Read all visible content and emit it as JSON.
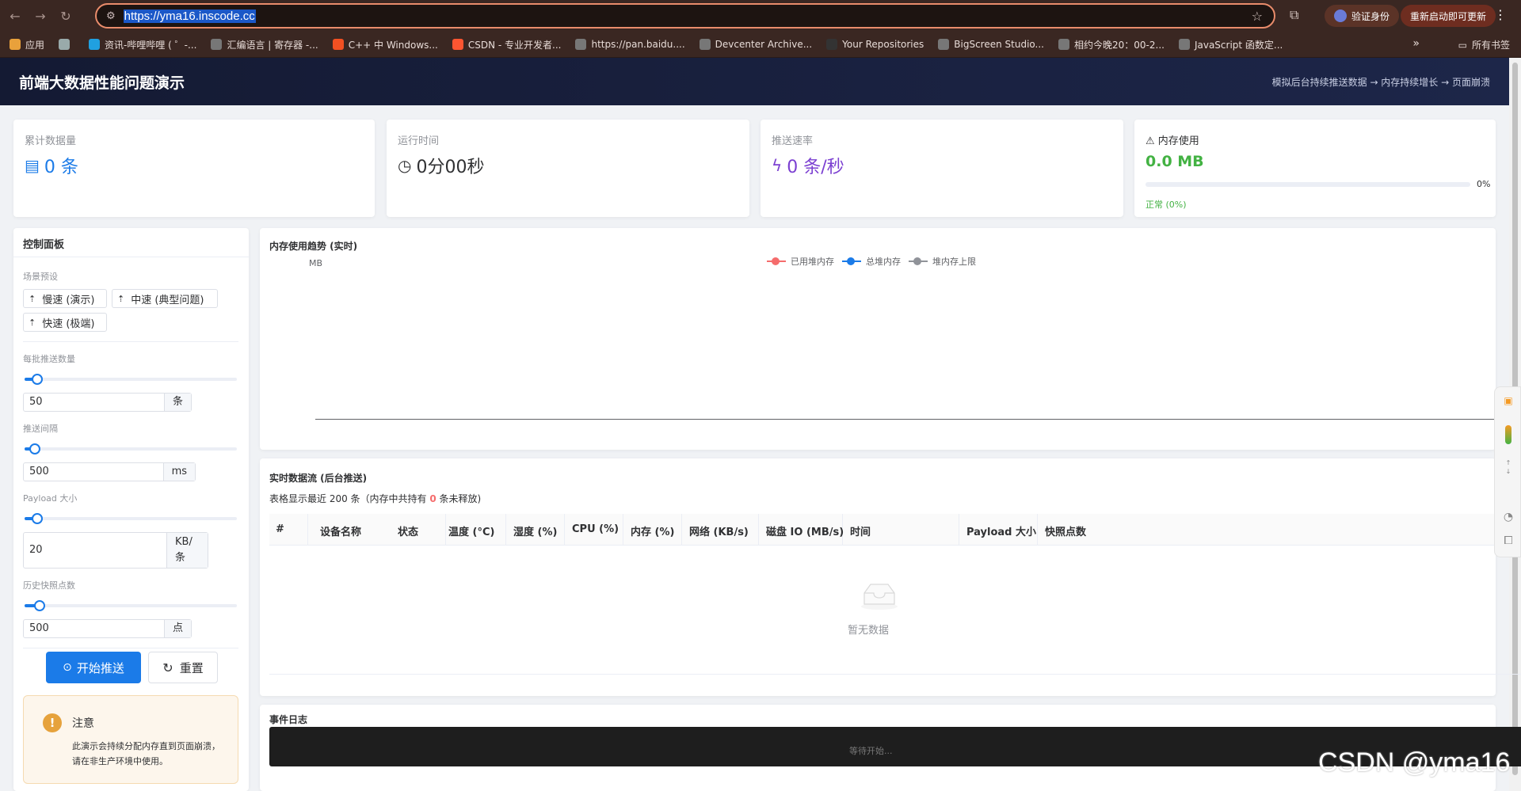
{
  "browser": {
    "url": "https://yma16.inscode.cc",
    "verify_label": "验证身份",
    "update_label": "重新启动即可更新",
    "bookmarks": [
      {
        "label": "应用",
        "color": "#e9a13b"
      },
      {
        "label": "",
        "color": "#9aa"
      },
      {
        "label": "资讯-哔哩哔哩 ( ゜-...",
        "color": "#20a0e0"
      },
      {
        "label": "汇编语言 | 寄存器 -...",
        "color": "#777"
      },
      {
        "label": "C++ 中 Windows...",
        "color": "#f25022"
      },
      {
        "label": "CSDN - 专业开发者...",
        "color": "#fc5531"
      },
      {
        "label": "https://pan.baidu....",
        "color": "#777"
      },
      {
        "label": "Devcenter Archive...",
        "color": "#777"
      },
      {
        "label": "Your Repositories",
        "color": "#333"
      },
      {
        "label": "BigScreen Studio...",
        "color": "#777"
      },
      {
        "label": "相约今晚20：00-2...",
        "color": "#777"
      },
      {
        "label": "JavaScript 函数定...",
        "color": "#777"
      }
    ],
    "all_bookmarks_label": "所有书签"
  },
  "header": {
    "title": "前端大数据性能问题演示",
    "subtitle": "模拟后台持续推送数据 → 内存持续增长 → 页面崩溃"
  },
  "stats": {
    "count": {
      "label": "累计数据量",
      "value": "0 条"
    },
    "runtime": {
      "label": "运行时间",
      "value": "0分00秒"
    },
    "rate": {
      "label": "推送速率",
      "value": "0 条/秒"
    },
    "memory": {
      "label": "内存使用",
      "value": "0.0 MB",
      "percent_text": "0%",
      "percent": 0,
      "status": "正常 (0%)"
    }
  },
  "control": {
    "title": "控制面板",
    "presets_label": "场景预设",
    "presets": [
      "慢速 (演示)",
      "中速 (典型问题)",
      "快速 (极端)"
    ],
    "batch": {
      "label": "每批推送数量",
      "value": "50",
      "unit": "条",
      "level": 0.06
    },
    "interval": {
      "label": "推送间隔",
      "value": "500",
      "unit": "ms",
      "level": 0.05
    },
    "payload": {
      "label": "Payload 大小",
      "value": "20",
      "unit": "KB/条",
      "level": 0.06
    },
    "snapshots": {
      "label": "历史快照点数",
      "value": "500",
      "unit": "点",
      "level": 0.07
    },
    "start_label": "开始推送",
    "reset_label": "重置",
    "notice_title": "注意",
    "notice_body": "此演示会持续分配内存直到页面崩溃，请在非生产环境中使用。"
  },
  "chart": {
    "title": "内存使用趋势 (实时)",
    "unit": "MB",
    "legend": [
      {
        "name": "已用堆内存",
        "color": "#f56c6c"
      },
      {
        "name": "总堆内存",
        "color": "#1b7be8"
      },
      {
        "name": "堆内存上限",
        "color": "#909399"
      }
    ]
  },
  "chart_data": {
    "type": "line",
    "title": "内存使用趋势 (实时)",
    "ylabel": "MB",
    "series": [
      {
        "name": "已用堆内存",
        "values": []
      },
      {
        "name": "总堆内存",
        "values": []
      },
      {
        "name": "堆内存上限",
        "values": []
      }
    ]
  },
  "table": {
    "title": "实时数据流 (后台推送)",
    "sub_prefix": "表格显示最近 200 条（内存中共持有 ",
    "held_count": "0",
    "sub_suffix": " 条未释放)",
    "columns": [
      "#",
      "设备名称",
      "状态",
      "温度 (°C)",
      "湿度 (%)",
      "CPU (%)",
      "内存 (%)",
      "网络 (KB/s)",
      "磁盘 IO (MB/s)",
      "时间",
      "Payload 大小",
      "快照点数"
    ],
    "empty_text": "暂无数据"
  },
  "log": {
    "title": "事件日志",
    "placeholder": "等待开始..."
  },
  "watermark": "CSDN @yma16"
}
